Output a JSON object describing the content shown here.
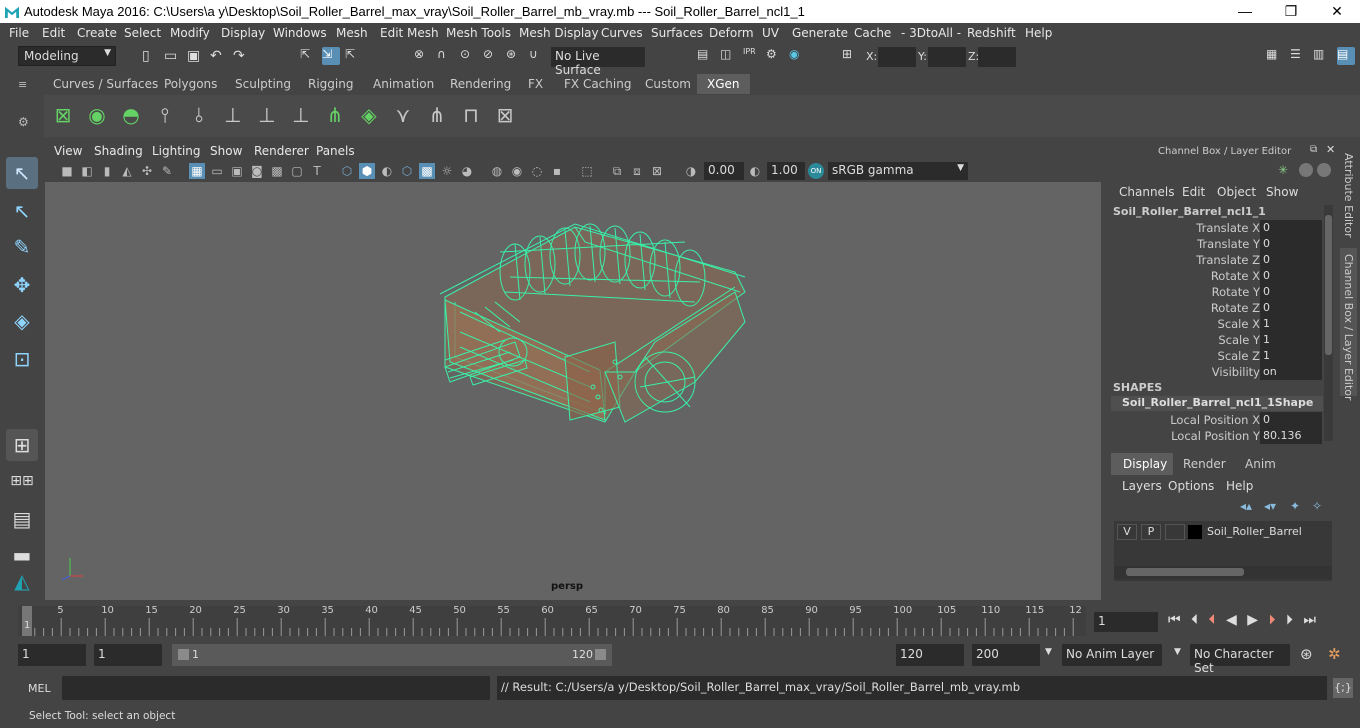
{
  "window": {
    "title": "Autodesk Maya 2016: C:\\Users\\a y\\Desktop\\Soil_Roller_Barrel_max_vray\\Soil_Roller_Barrel_mb_vray.mb  ---  Soil_Roller_Barrel_ncl1_1",
    "minimize": "—",
    "maximize": "❐",
    "close": "✕"
  },
  "menubar": [
    "File",
    "Edit",
    "Create",
    "Select",
    "Modify",
    "Display",
    "Windows",
    "Mesh",
    "Edit Mesh",
    "Mesh Tools",
    "Mesh Display",
    "Curves",
    "Surfaces",
    "Deform",
    "UV",
    "Generate",
    "Cache",
    "- 3DtoAll -",
    "Redshift",
    "Help"
  ],
  "status": {
    "mode": "Modeling",
    "live_surface": "No Live Surface",
    "x_label": "X:",
    "y_label": "Y:",
    "z_label": "Z:"
  },
  "shelf_tabs": [
    "Curves / Surfaces",
    "Polygons",
    "Sculpting",
    "Rigging",
    "Animation",
    "Rendering",
    "FX",
    "FX Caching",
    "Custom",
    "XGen"
  ],
  "shelf_active": "XGen",
  "viewport": {
    "menus": [
      "View",
      "Shading",
      "Lighting",
      "Show",
      "Renderer",
      "Panels"
    ],
    "exposure": "0.00",
    "gamma": "1.00",
    "colorspace": "sRGB gamma",
    "camera_label": "persp"
  },
  "channelbox": {
    "header": "Channel Box / Layer Editor",
    "menus": [
      "Channels",
      "Edit",
      "Object",
      "Show"
    ],
    "object": "Soil_Roller_Barrel_ncl1_1",
    "channels": [
      {
        "label": "Translate X",
        "value": "0"
      },
      {
        "label": "Translate Y",
        "value": "0"
      },
      {
        "label": "Translate Z",
        "value": "0"
      },
      {
        "label": "Rotate X",
        "value": "0"
      },
      {
        "label": "Rotate Y",
        "value": "0"
      },
      {
        "label": "Rotate Z",
        "value": "0"
      },
      {
        "label": "Scale X",
        "value": "1"
      },
      {
        "label": "Scale Y",
        "value": "1"
      },
      {
        "label": "Scale Z",
        "value": "1"
      },
      {
        "label": "Visibility",
        "value": "on"
      }
    ],
    "shapes_header": "SHAPES",
    "shape_name": "Soil_Roller_Barrel_ncl1_1Shape",
    "shape_channels": [
      {
        "label": "Local Position X",
        "value": "0"
      },
      {
        "label": "Local Position Y",
        "value": "80.136"
      }
    ],
    "side_tabs": [
      "Attribute Editor",
      "Channel Box / Layer Editor"
    ]
  },
  "layers": {
    "tabs": [
      "Display",
      "Render",
      "Anim"
    ],
    "active_tab": "Display",
    "menus": [
      "Layers",
      "Options",
      "Help"
    ],
    "layer": {
      "v": "V",
      "p": "P",
      "name": "Soil_Roller_Barrel"
    }
  },
  "timeline": {
    "ticks": [
      "5",
      "10",
      "15",
      "20",
      "25",
      "30",
      "35",
      "40",
      "45",
      "50",
      "55",
      "60",
      "65",
      "70",
      "75",
      "80",
      "85",
      "90",
      "95",
      "100",
      "105",
      "110",
      "115",
      "12"
    ],
    "start_marker": "1",
    "current": "1"
  },
  "range": {
    "start": "1",
    "inner_start": "1",
    "slider_start": "1",
    "slider_end": "120",
    "end": "120",
    "anim_end": "200",
    "anim_layer": "No Anim Layer",
    "char_set": "No Character Set"
  },
  "command": {
    "lang": "MEL",
    "input": "",
    "result": "// Result: C:/Users/a y/Desktop/Soil_Roller_Barrel_max_vray/Soil_Roller_Barrel_mb_vray.mb"
  },
  "help": "Select Tool: select an object"
}
